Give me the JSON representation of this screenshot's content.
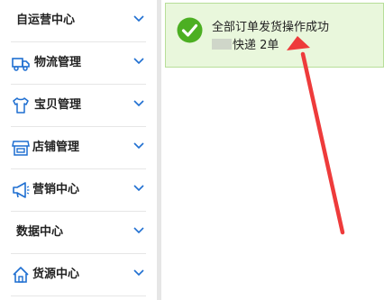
{
  "sidebar": {
    "items": [
      {
        "label": "自运营中心",
        "icon": "none"
      },
      {
        "label": "物流管理",
        "icon": "truck-icon"
      },
      {
        "label": "宝贝管理",
        "icon": "shirt-icon"
      },
      {
        "label": "店铺管理",
        "icon": "store-icon"
      },
      {
        "label": "营销中心",
        "icon": "megaphone-icon"
      },
      {
        "label": "数据中心",
        "icon": "none"
      },
      {
        "label": "货源中心",
        "icon": "house-icon"
      }
    ]
  },
  "notice": {
    "line1": "全部订单发货操作成功",
    "line2": "快递 2单",
    "accent": "#4caf22"
  },
  "colors": {
    "icon_blue": "#1f6fd1",
    "arrow_red": "#ee3b3b"
  }
}
